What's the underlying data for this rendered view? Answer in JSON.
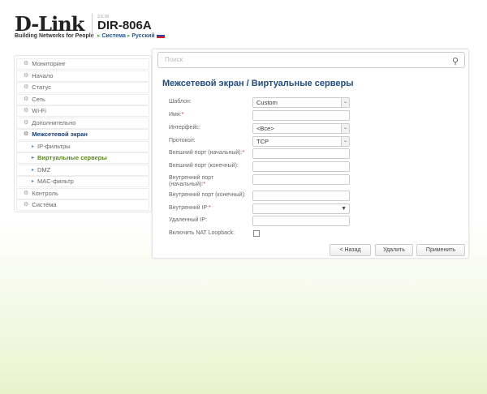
{
  "header": {
    "brand": "D-Link",
    "tagline": "Building Networks for People",
    "version": "2.6.18",
    "model": "DIR-806A",
    "breadcrumb": [
      "Система",
      "Русский"
    ]
  },
  "sidebar": {
    "items": [
      {
        "label": "Мониторинг"
      },
      {
        "label": "Начало"
      },
      {
        "label": "Статус"
      },
      {
        "label": "Сеть"
      },
      {
        "label": "Wi-Fi"
      },
      {
        "label": "Дополнительно"
      },
      {
        "label": "Межсетевой экран"
      },
      {
        "label": "IP-фильтры"
      },
      {
        "label": "Виртуальные серверы"
      },
      {
        "label": "DMZ"
      },
      {
        "label": "MAC-фильтр"
      },
      {
        "label": "Контроль"
      },
      {
        "label": "Система"
      }
    ]
  },
  "search": {
    "placeholder": "Поиск"
  },
  "page_title": "Межсетевой экран /  Виртуальные серверы",
  "form": {
    "template": {
      "label": "Шаблон:",
      "value": "Custom"
    },
    "name": {
      "label": "Имя:",
      "value": ""
    },
    "interface": {
      "label": "Интерфейс:",
      "value": "<Все>"
    },
    "protocol": {
      "label": "Протокол:",
      "value": "TCP"
    },
    "ext_start": {
      "label": "Внешний порт (начальный):",
      "value": ""
    },
    "ext_end": {
      "label": "Внешний порт (конечный):",
      "value": ""
    },
    "int_start": {
      "label": "Внутренний порт (начальный):",
      "value": ""
    },
    "int_end": {
      "label": "Внутренний порт (конечный):",
      "value": ""
    },
    "int_ip": {
      "label": "Внутренний IP:",
      "value": ""
    },
    "remote_ip": {
      "label": "Удаленный IP:",
      "value": ""
    },
    "nat_loopback": {
      "label": "Включить NAT Loopback:",
      "checked": false
    },
    "required_mark": "*"
  },
  "buttons": {
    "back": "< Назад",
    "delete": "Удалить",
    "apply": "Применить"
  }
}
